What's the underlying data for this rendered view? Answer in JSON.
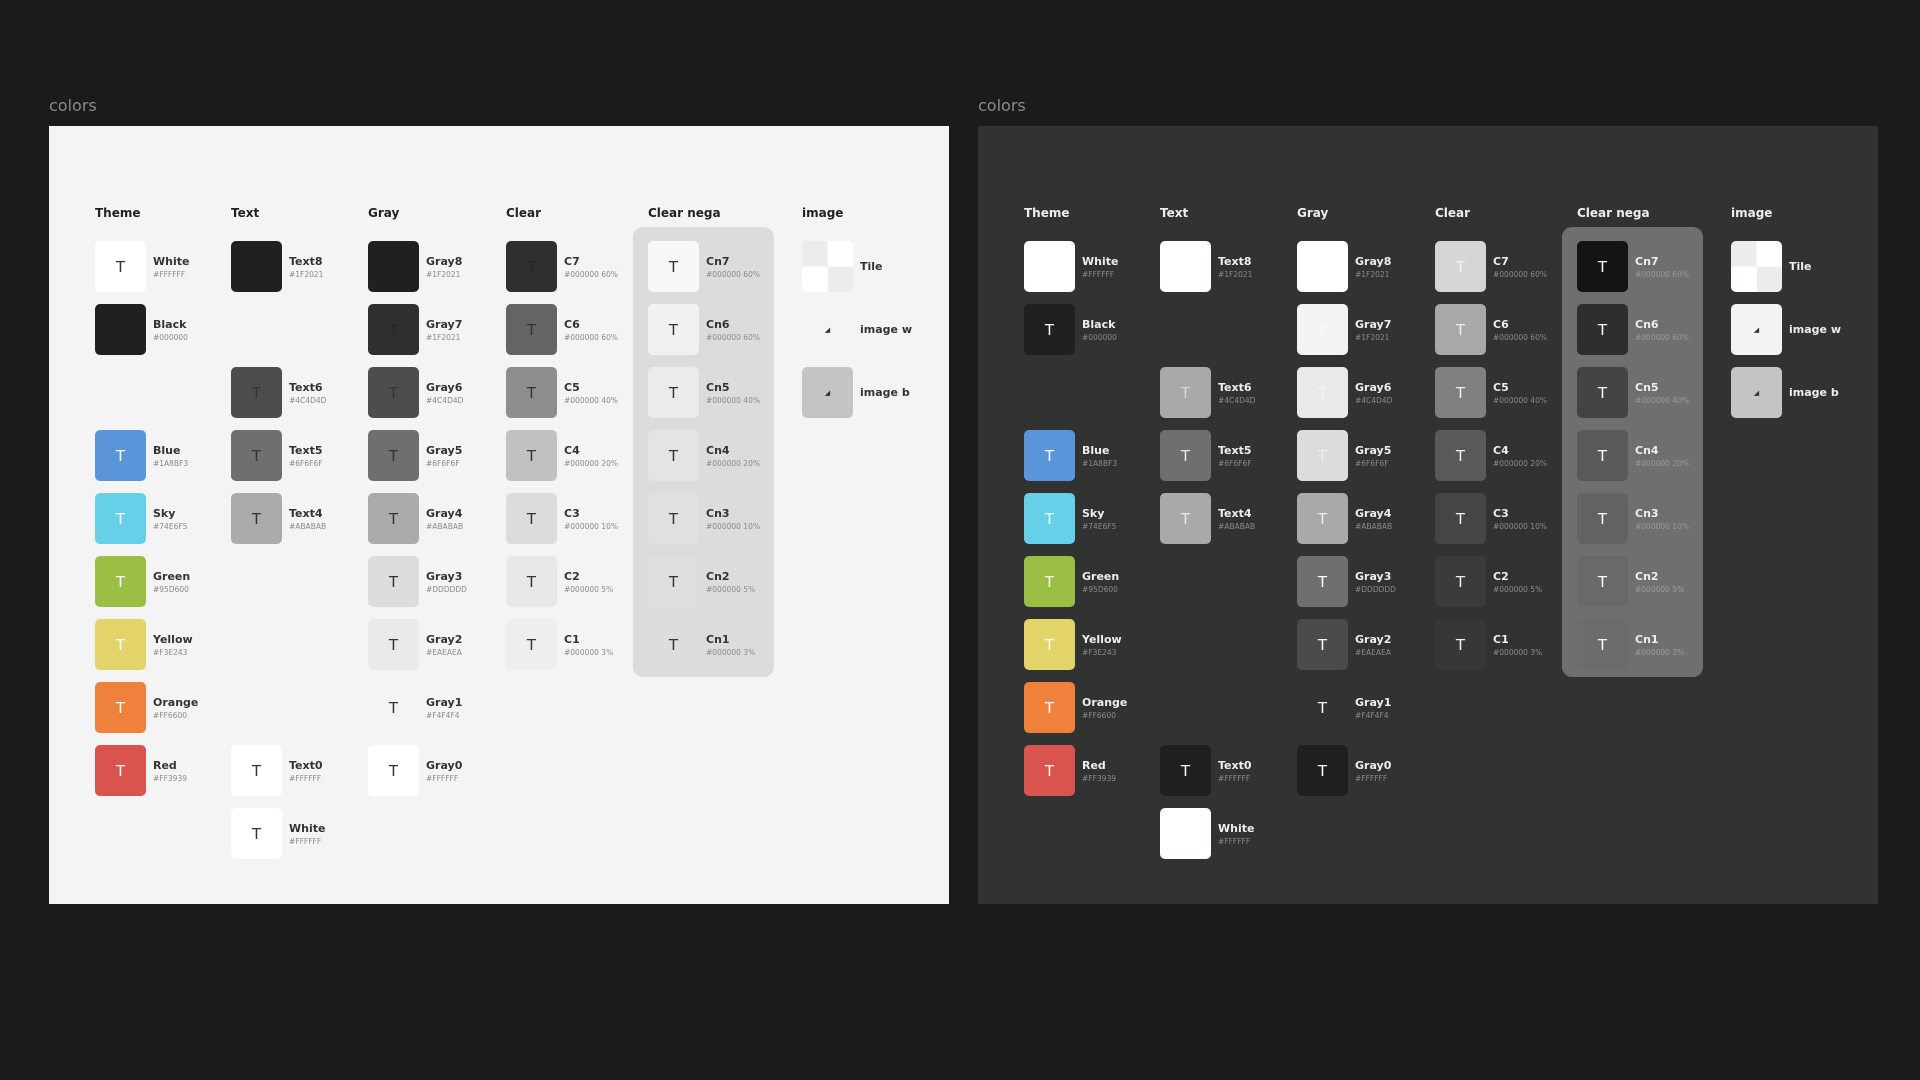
{
  "frames": [
    {
      "title": "colors",
      "theme": "light",
      "background": "#F4F4F4",
      "name_color": "#333333",
      "hex_color": "#8A8A8A",
      "header_color": "#222222",
      "nega_background": "#DCDCDC",
      "columns": [
        {
          "title": "Theme",
          "items": [
            {
              "name": "White",
              "hex": "#FFFFFF",
              "fill": "#FFFFFF",
              "t": "#333333"
            },
            {
              "name": "Black",
              "hex": "#000000",
              "fill": "#1F2021",
              "t": ""
            },
            null,
            {
              "name": "Blue",
              "hex": "#1A8BF3",
              "fill": "#5B95D9",
              "t": "#FFFFFF"
            },
            {
              "name": "Sky",
              "hex": "#74E6F5",
              "fill": "#66D0E8",
              "t": "#FFFFFF"
            },
            {
              "name": "Green",
              "hex": "#95D600",
              "fill": "#9BBF44",
              "t": "#FFFFFF"
            },
            {
              "name": "Yellow",
              "hex": "#F3E243",
              "fill": "#E3D46A",
              "t": "#FFFFFF"
            },
            {
              "name": "Orange",
              "hex": "#FF6600",
              "fill": "#F0813C",
              "t": "#FFFFFF"
            },
            {
              "name": "Red",
              "hex": "#FF3939",
              "fill": "#D9534F",
              "t": "#FFFFFF"
            }
          ]
        },
        {
          "title": "Text",
          "items": [
            {
              "name": "Text8",
              "hex": "#1F2021",
              "fill": "#1F2021",
              "t": ""
            },
            null,
            {
              "name": "Text6",
              "hex": "#4C4D4D",
              "fill": "#4C4D4D",
              "t": "#333333"
            },
            {
              "name": "Text5",
              "hex": "#6F6F6F",
              "fill": "#6F6F6F",
              "t": "#333333"
            },
            {
              "name": "Text4",
              "hex": "#ABABAB",
              "fill": "#ABABAB",
              "t": "#333333"
            },
            null,
            null,
            null,
            {
              "name": "Text0",
              "hex": "#FFFFFF",
              "fill": "#FFFFFF",
              "t": "#333333"
            },
            {
              "name": "White",
              "hex": "#FFFFFF",
              "fill": "#FFFFFF",
              "t": "#333333"
            }
          ]
        },
        {
          "title": "Gray",
          "items": [
            {
              "name": "Gray8",
              "hex": "#1F2021",
              "fill": "#1F2021",
              "t": ""
            },
            {
              "name": "Gray7",
              "hex": "#1F2021",
              "fill": "#2E2F2F",
              "t": "#262727"
            },
            {
              "name": "Gray6",
              "hex": "#4C4D4D",
              "fill": "#4C4D4D",
              "t": "#333333"
            },
            {
              "name": "Gray5",
              "hex": "#6F6F6F",
              "fill": "#6F6F6F",
              "t": "#333333"
            },
            {
              "name": "Gray4",
              "hex": "#ABABAB",
              "fill": "#ABABAB",
              "t": "#333333"
            },
            {
              "name": "Gray3",
              "hex": "#DDDDDD",
              "fill": "#DDDDDD",
              "t": "#333333"
            },
            {
              "name": "Gray2",
              "hex": "#EAEAEA",
              "fill": "#EAEAEA",
              "t": "#333333"
            },
            {
              "name": "Gray1",
              "hex": "#F4F4F4",
              "fill": "#F4F4F4",
              "t": "#333333"
            },
            {
              "name": "Gray0",
              "hex": "#FFFFFF",
              "fill": "#FFFFFF",
              "t": "#333333"
            }
          ]
        },
        {
          "title": "Clear",
          "items": [
            {
              "name": "C7",
              "hex": "#000000 60%",
              "fill": "#2F2F2F",
              "t": "#262626"
            },
            {
              "name": "C6",
              "hex": "#000000 60%",
              "fill": "#646464",
              "t": "#333333"
            },
            {
              "name": "C5",
              "hex": "#000000 40%",
              "fill": "#8E8E8E",
              "t": "#333333"
            },
            {
              "name": "C4",
              "hex": "#000000 20%",
              "fill": "#C1C1C1",
              "t": "#333333"
            },
            {
              "name": "C3",
              "hex": "#000000 10%",
              "fill": "#DCDCDC",
              "t": "#333333"
            },
            {
              "name": "C2",
              "hex": "#000000 5%",
              "fill": "#E8E8E8",
              "t": "#333333"
            },
            {
              "name": "C1",
              "hex": "#000000 3%",
              "fill": "#EEEEEE",
              "t": "#333333"
            }
          ]
        },
        {
          "title": "Clear nega",
          "nega": true,
          "items": [
            {
              "name": "Cn7",
              "hex": "#000000 60%",
              "fill": "#F8F8F8",
              "t": "#333333"
            },
            {
              "name": "Cn6",
              "hex": "#000000 60%",
              "fill": "#F1F1F1",
              "t": "#333333"
            },
            {
              "name": "Cn5",
              "hex": "#000000 40%",
              "fill": "#EBEBEB",
              "t": "#333333"
            },
            {
              "name": "Cn4",
              "hex": "#000000 20%",
              "fill": "#E4E4E4",
              "t": "#333333"
            },
            {
              "name": "Cn3",
              "hex": "#000000 10%",
              "fill": "#E0E0E0",
              "t": "#333333"
            },
            {
              "name": "Cn2",
              "hex": "#000000 5%",
              "fill": "#DEDEDE",
              "t": "#333333"
            },
            {
              "name": "Cn1",
              "hex": "#000000 3%",
              "fill": "#DDDDDD",
              "t": "#333333"
            }
          ]
        },
        {
          "title": "image",
          "items": [
            {
              "name": "Tile",
              "kind": "tile"
            },
            {
              "name": "image w",
              "kind": "image",
              "fill": "transparent"
            },
            {
              "name": "image b",
              "kind": "image",
              "fill": "#C4C4C4"
            }
          ]
        }
      ]
    },
    {
      "title": "colors",
      "theme": "dark",
      "background": "#313232",
      "name_color": "#EEEEEE",
      "hex_color": "#8A8A8A",
      "header_color": "#EEEEEE",
      "nega_background": "#6F6F6F",
      "columns": [
        {
          "title": "Theme",
          "items": [
            {
              "name": "White",
              "hex": "#FFFFFF",
              "fill": "#FFFFFF",
              "t": ""
            },
            {
              "name": "Black",
              "hex": "#000000",
              "fill": "#1F2021",
              "t": "#FFFFFF"
            },
            null,
            {
              "name": "Blue",
              "hex": "#1A8BF3",
              "fill": "#5B95D9",
              "t": "#FFFFFF"
            },
            {
              "name": "Sky",
              "hex": "#74E6F5",
              "fill": "#66D0E8",
              "t": "#FFFFFF"
            },
            {
              "name": "Green",
              "hex": "#95D600",
              "fill": "#9BBF44",
              "t": "#FFFFFF"
            },
            {
              "name": "Yellow",
              "hex": "#F3E243",
              "fill": "#E3D46A",
              "t": "#FFFFFF"
            },
            {
              "name": "Orange",
              "hex": "#FF6600",
              "fill": "#F0813C",
              "t": "#FFFFFF"
            },
            {
              "name": "Red",
              "hex": "#FF3939",
              "fill": "#D9534F",
              "t": "#FFFFFF"
            }
          ]
        },
        {
          "title": "Text",
          "items": [
            {
              "name": "Text8",
              "hex": "#1F2021",
              "fill": "#FFFFFF",
              "t": ""
            },
            null,
            {
              "name": "Text6",
              "hex": "#4C4D4D",
              "fill": "#A9A9A9",
              "t": "#D8D8D8"
            },
            {
              "name": "Text5",
              "hex": "#6F6F6F",
              "fill": "#6F6F6F",
              "t": "#E8E8E8"
            },
            {
              "name": "Text4",
              "hex": "#ABABAB",
              "fill": "#A9A9A9",
              "t": "#E8E8E8"
            },
            null,
            null,
            null,
            {
              "name": "Text0",
              "hex": "#FFFFFF",
              "fill": "#1F2021",
              "t": "#FFFFFF"
            },
            {
              "name": "White",
              "hex": "#FFFFFF",
              "fill": "#FFFFFF",
              "t": ""
            }
          ]
        },
        {
          "title": "Gray",
          "items": [
            {
              "name": "Gray8",
              "hex": "#1F2021",
              "fill": "#FFFFFF",
              "t": ""
            },
            {
              "name": "Gray7",
              "hex": "#1F2021",
              "fill": "#F3F3F3",
              "t": "#FAFAFA"
            },
            {
              "name": "Gray6",
              "hex": "#4C4D4D",
              "fill": "#E9E9E9",
              "t": "#F4F4F4"
            },
            {
              "name": "Gray5",
              "hex": "#6F6F6F",
              "fill": "#DCDCDC",
              "t": "#EEEEEE"
            },
            {
              "name": "Gray4",
              "hex": "#ABABAB",
              "fill": "#A9A9A9",
              "t": "#EEEEEE"
            },
            {
              "name": "Gray3",
              "hex": "#DDDDDD",
              "fill": "#6F6F6F",
              "t": "#FFFFFF"
            },
            {
              "name": "Gray2",
              "hex": "#EAEAEA",
              "fill": "#4A4B4B",
              "t": "#FFFFFF"
            },
            {
              "name": "Gray1",
              "hex": "#F4F4F4",
              "fill": "transparent",
              "t": "#FFFFFF"
            },
            {
              "name": "Gray0",
              "hex": "#FFFFFF",
              "fill": "#1F2021",
              "t": "#FFFFFF"
            }
          ]
        },
        {
          "title": "Clear",
          "items": [
            {
              "name": "C7",
              "hex": "#000000 60%",
              "fill": "#D5D5D5",
              "t": "#F0F0F0"
            },
            {
              "name": "C6",
              "hex": "#000000 60%",
              "fill": "#A8A8A8",
              "t": "#F0F0F0"
            },
            {
              "name": "C5",
              "hex": "#000000 40%",
              "fill": "#808080",
              "t": "#F0F0F0"
            },
            {
              "name": "C4",
              "hex": "#000000 20%",
              "fill": "#5A5A5A",
              "t": "#F0F0F0"
            },
            {
              "name": "C3",
              "hex": "#000000 10%",
              "fill": "#444545",
              "t": "#F0F0F0"
            },
            {
              "name": "C2",
              "hex": "#000000 5%",
              "fill": "#3A3B3B",
              "t": "#F0F0F0"
            },
            {
              "name": "C1",
              "hex": "#000000 3%",
              "fill": "#363737",
              "t": "#F0F0F0"
            }
          ]
        },
        {
          "title": "Clear nega",
          "nega": true,
          "hex_color": "#9A9A9A",
          "items": [
            {
              "name": "Cn7",
              "hex": "#000000 60%",
              "fill": "#141414",
              "t": "#FFFFFF"
            },
            {
              "name": "Cn6",
              "hex": "#000000 60%",
              "fill": "#2E2E2E",
              "t": "#FFFFFF"
            },
            {
              "name": "Cn5",
              "hex": "#000000 40%",
              "fill": "#434343",
              "t": "#FFFFFF"
            },
            {
              "name": "Cn4",
              "hex": "#000000 20%",
              "fill": "#595959",
              "t": "#FFFFFF"
            },
            {
              "name": "Cn3",
              "hex": "#000000 10%",
              "fill": "#626262",
              "t": "#FFFFFF"
            },
            {
              "name": "Cn2",
              "hex": "#000000 5%",
              "fill": "#696969",
              "t": "#FFFFFF"
            },
            {
              "name": "Cn1",
              "hex": "#000000 3%",
              "fill": "#6C6C6C",
              "t": "#FFFFFF"
            }
          ]
        },
        {
          "title": "image",
          "items": [
            {
              "name": "Tile",
              "kind": "tile"
            },
            {
              "name": "image w",
              "kind": "image",
              "fill": "#F3F3F3"
            },
            {
              "name": "image b",
              "kind": "image",
              "fill": "#C4C4C4"
            }
          ]
        }
      ]
    }
  ],
  "swatch_letter": "T",
  "image_glyph": "◢"
}
